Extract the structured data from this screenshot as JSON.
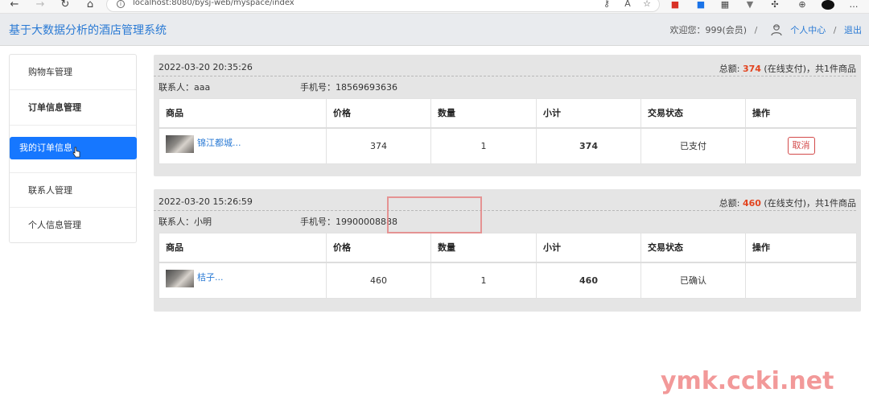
{
  "browser": {
    "url": "localhost:8080/bysj-web/myspace/index",
    "nav_icons": [
      "back-icon",
      "forward-icon",
      "refresh-icon",
      "home-icon"
    ],
    "address_icons": [
      "key-icon",
      "read-aloud-icon",
      "favorite-icon"
    ],
    "extension_icons": [
      "extension-red-icon",
      "extension-blue-icon",
      "extension-qr-icon",
      "extension-filter-icon",
      "extensions-puzzle-icon",
      "collections-icon",
      "profile-avatar-icon",
      "more-icon"
    ]
  },
  "header": {
    "title": "基于大数据分析的酒店管理系统",
    "welcome": "欢迎您：999(会员)",
    "sep1": "/",
    "user_center": "个人中心",
    "sep2": "/",
    "logout": "退出",
    "accent_color": "#2a7ad4"
  },
  "sidebar": {
    "items": [
      {
        "label": "购物车管理"
      },
      {
        "label": "订单信息管理"
      },
      {
        "label": "我的订单信息"
      },
      {
        "label": "联系人管理"
      },
      {
        "label": "个人信息管理"
      }
    ],
    "active_color": "#1677ff"
  },
  "table_headers": [
    "商品",
    "价格",
    "数量",
    "小计",
    "交易状态",
    "操作"
  ],
  "orders": [
    {
      "time": "2022-03-20 20:35:26",
      "total_prefix": "总额:",
      "total_amount": "374",
      "total_suffix": "(在线支付)，共1件商品",
      "contact": "联系人：aaa",
      "phone": "手机号：18569693636",
      "item": {
        "name": "锦江都城...",
        "price": "374",
        "qty": "1",
        "subtotal": "374",
        "status": "已支付",
        "action": "取消"
      }
    },
    {
      "time": "2022-03-20 15:26:59",
      "total_prefix": "总额:",
      "total_amount": "460",
      "total_suffix": "(在线支付)，共1件商品",
      "contact": "联系人：小明",
      "phone": "手机号：19900008888",
      "item": {
        "name": "桔子...",
        "price": "460",
        "qty": "1",
        "subtotal": "460",
        "status": "已确认",
        "action": ""
      }
    }
  ],
  "watermarks": {
    "box_text": " ",
    "site_text": "ymk.ccki.net"
  },
  "colors": {
    "amount": "#e2441f",
    "cancel_border": "#d34b4b"
  }
}
